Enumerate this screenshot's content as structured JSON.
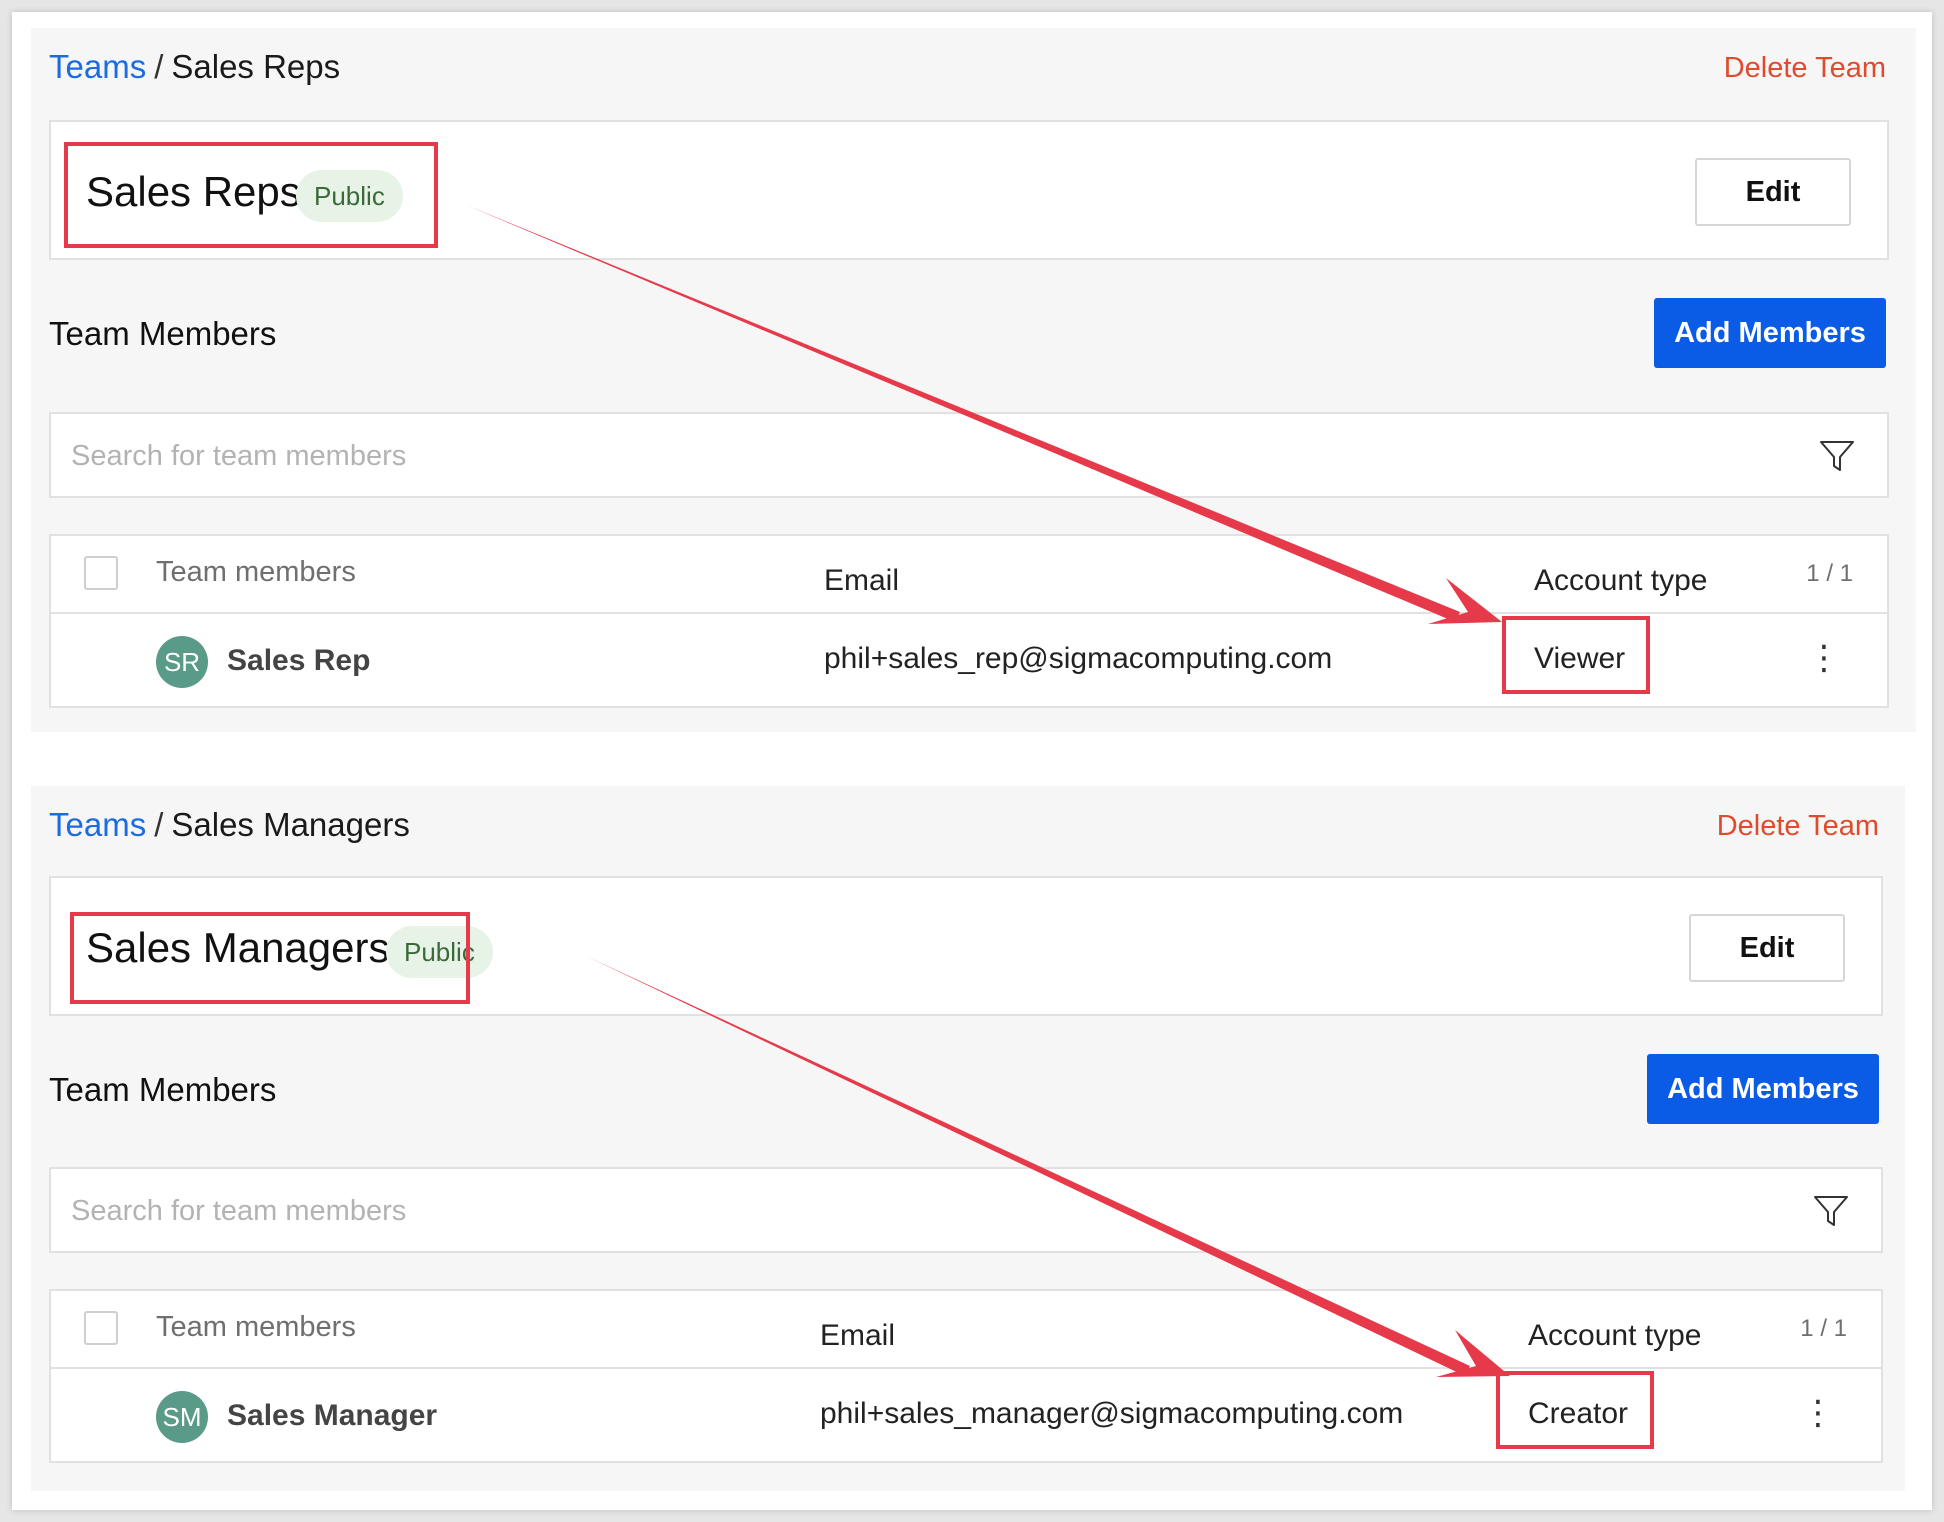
{
  "colors": {
    "link": "#1a6ce0",
    "danger": "#e04b2d",
    "primary_button": "#0a5be6",
    "annotation": "#e63a4a",
    "badge_bg": "#e8f3e7",
    "avatar": "#5a9a88"
  },
  "panels": [
    {
      "breadcrumb": {
        "root": "Teams",
        "separator": "/",
        "current": "Sales Reps"
      },
      "delete_label": "Delete Team",
      "team_name": "Sales Reps",
      "visibility_badge": "Public",
      "edit_label": "Edit",
      "section_title": "Team Members",
      "add_members_label": "Add Members",
      "search_placeholder": "Search for team members",
      "filter_icon": "filter-icon",
      "columns": {
        "members": "Team members",
        "email": "Email",
        "account_type": "Account type",
        "count": "1 / 1"
      },
      "rows": [
        {
          "initials": "SR",
          "name": "Sales Rep",
          "email": "phil+sales_rep@sigmacomputing.com",
          "account_type": "Viewer",
          "menu_icon": "⋮"
        }
      ]
    },
    {
      "breadcrumb": {
        "root": "Teams",
        "separator": "/",
        "current": "Sales Managers"
      },
      "delete_label": "Delete Team",
      "team_name": "Sales Managers",
      "visibility_badge": "Public",
      "edit_label": "Edit",
      "section_title": "Team Members",
      "add_members_label": "Add Members",
      "search_placeholder": "Search for team members",
      "filter_icon": "filter-icon",
      "columns": {
        "members": "Team members",
        "email": "Email",
        "account_type": "Account type",
        "count": "1 / 1"
      },
      "rows": [
        {
          "initials": "SM",
          "name": "Sales Manager",
          "email": "phil+sales_manager@sigmacomputing.com",
          "account_type": "Creator",
          "menu_icon": "⋮"
        }
      ]
    }
  ]
}
